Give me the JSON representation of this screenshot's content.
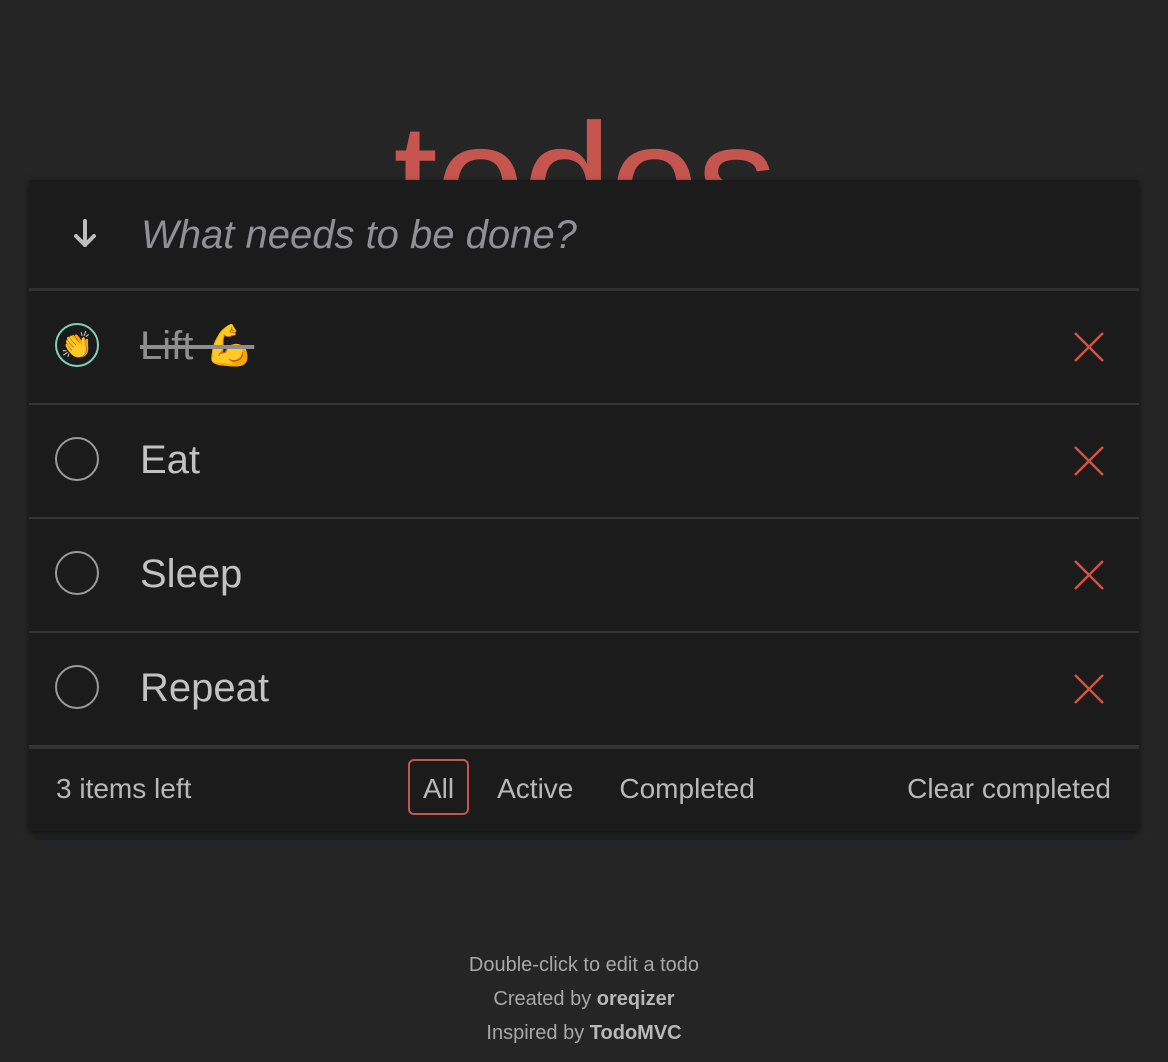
{
  "app": {
    "title": "todos",
    "accent_color": "#c65550"
  },
  "header": {
    "toggle_all_icon": "arrow-down-icon",
    "new_todo_placeholder": "What needs to be done?",
    "new_todo_value": ""
  },
  "todos": [
    {
      "label": "Lift 💪",
      "completed": true,
      "check_icon": "clapping-hands-icon",
      "check_glyph": "👏"
    },
    {
      "label": "Eat",
      "completed": false
    },
    {
      "label": "Sleep",
      "completed": false
    },
    {
      "label": "Repeat",
      "completed": false
    }
  ],
  "footer": {
    "count_text": "3 items left",
    "filters": [
      {
        "label": "All",
        "selected": true
      },
      {
        "label": "Active",
        "selected": false
      },
      {
        "label": "Completed",
        "selected": false
      }
    ],
    "clear_completed_label": "Clear completed"
  },
  "info": {
    "edit_hint": "Double-click to edit a todo",
    "created_prefix": "Created by ",
    "created_author": "oreqizer",
    "inspired_prefix": "Inspired by ",
    "inspired_project": "TodoMVC"
  },
  "colors": {
    "background": "#252525",
    "panel": "#1b1b1b",
    "destroy_x": "#d4513f",
    "completed_ring": "#7fd3b4"
  }
}
